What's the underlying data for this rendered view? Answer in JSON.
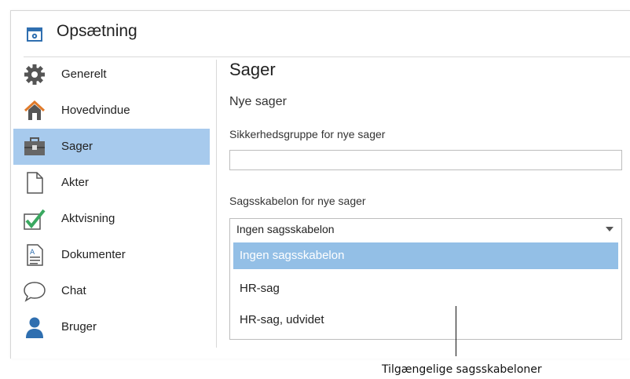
{
  "window": {
    "title": "Opsætning"
  },
  "sidebar": {
    "items": [
      {
        "label": "Generelt",
        "icon": "gear-icon",
        "active": false
      },
      {
        "label": "Hovedvindue",
        "icon": "home-icon",
        "active": false
      },
      {
        "label": "Sager",
        "icon": "briefcase-icon",
        "active": true
      },
      {
        "label": "Akter",
        "icon": "document-icon",
        "active": false
      },
      {
        "label": "Aktvisning",
        "icon": "checkmark-icon",
        "active": false
      },
      {
        "label": "Dokumenter",
        "icon": "text-document-icon",
        "active": false
      },
      {
        "label": "Chat",
        "icon": "chat-bubble-icon",
        "active": false
      },
      {
        "label": "Bruger",
        "icon": "user-icon",
        "active": false
      }
    ]
  },
  "content": {
    "heading": "Sager",
    "subheading": "Nye sager",
    "security_group_label": "Sikkerhedsgruppe for nye sager",
    "security_group_value": "",
    "template_label": "Sagsskabelon for nye sager",
    "template_value": "Ingen sagsskabelon",
    "template_options": [
      "Ingen sagsskabelon",
      "HR-sag",
      "HR-sag, udvidet"
    ],
    "selected_option_index": 0
  },
  "annotation": {
    "text": "Tilgængelige sagsskabeloner"
  },
  "colors": {
    "active_sidebar": "#a7caed",
    "selected_option": "#93bfe6",
    "icon_blue": "#2f6fb0",
    "check_green": "#3aa860"
  }
}
